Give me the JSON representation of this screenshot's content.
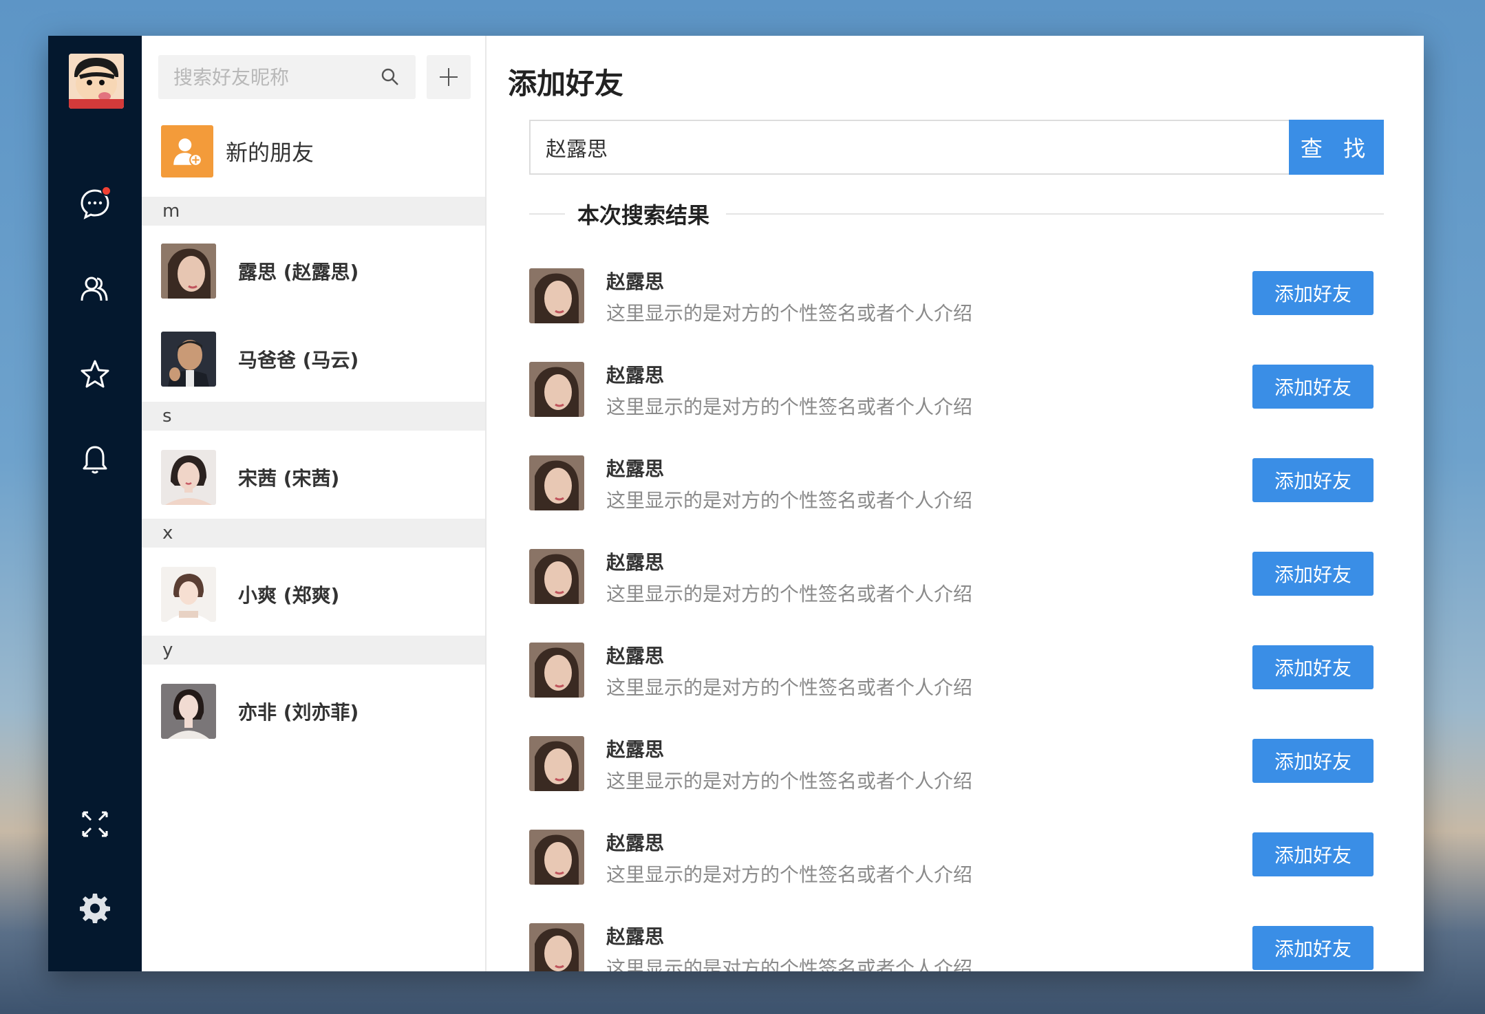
{
  "sidebar": {
    "nav_items": [
      {
        "icon": "chat-icon",
        "badge": true
      },
      {
        "icon": "contacts-icon",
        "active": true
      },
      {
        "icon": "star-icon"
      },
      {
        "icon": "bell-icon"
      }
    ],
    "bottom_items": [
      {
        "icon": "fullscreen-icon"
      },
      {
        "icon": "gear-icon"
      }
    ]
  },
  "contacts": {
    "search_placeholder": "搜索好友昵称",
    "new_friends_label": "新的朋友",
    "groups": [
      {
        "letter": "m",
        "items": [
          {
            "name": "露思 (赵露思)"
          },
          {
            "name": "马爸爸 (马云)"
          }
        ]
      },
      {
        "letter": "s",
        "items": [
          {
            "name": "宋茜 (宋茜)"
          }
        ]
      },
      {
        "letter": "x",
        "items": [
          {
            "name": "小爽 (郑爽)"
          }
        ]
      },
      {
        "letter": "y",
        "items": [
          {
            "name": "亦非 (刘亦菲)"
          }
        ]
      }
    ]
  },
  "main": {
    "title": "添加好友",
    "query_value": "赵露思",
    "find_label": "查 找",
    "results_heading": "本次搜索结果",
    "results": [
      {
        "name": "赵露思",
        "signature": "这里显示的是对方的个性签名或者个人介绍",
        "button": "添加好友"
      },
      {
        "name": "赵露思",
        "signature": "这里显示的是对方的个性签名或者个人介绍",
        "button": "添加好友"
      },
      {
        "name": "赵露思",
        "signature": "这里显示的是对方的个性签名或者个人介绍",
        "button": "添加好友"
      },
      {
        "name": "赵露思",
        "signature": "这里显示的是对方的个性签名或者个人介绍",
        "button": "添加好友"
      },
      {
        "name": "赵露思",
        "signature": "这里显示的是对方的个性签名或者个人介绍",
        "button": "添加好友"
      },
      {
        "name": "赵露思",
        "signature": "这里显示的是对方的个性签名或者个人介绍",
        "button": "添加好友"
      },
      {
        "name": "赵露思",
        "signature": "这里显示的是对方的个性签名或者个人介绍",
        "button": "添加好友"
      },
      {
        "name": "赵露思",
        "signature": "这里显示的是对方的个性签名或者个人介绍",
        "button": "添加好友"
      }
    ]
  },
  "colors": {
    "accent": "#3a8ee6",
    "rail": "#04182e",
    "badge": "#f04134",
    "new_friend": "#f39b3a"
  }
}
